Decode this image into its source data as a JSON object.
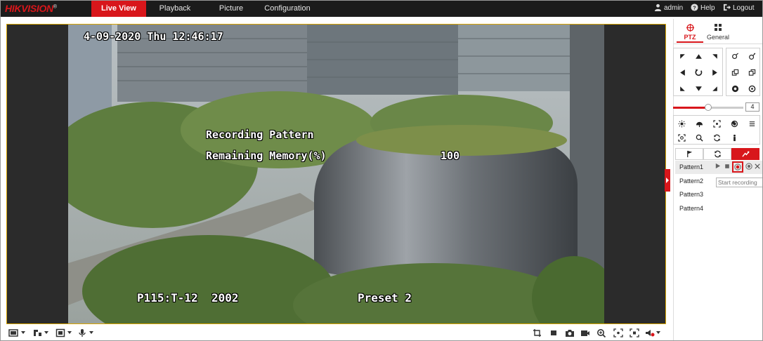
{
  "brand": {
    "logo_text": "HIKVISION",
    "logo_mark": "®"
  },
  "nav": {
    "tabs": [
      {
        "label": "Live View",
        "active": true
      },
      {
        "label": "Playback",
        "active": false
      },
      {
        "label": "Picture",
        "active": false
      },
      {
        "label": "Configuration",
        "active": false
      }
    ],
    "user": "admin",
    "help": "Help",
    "logout": "Logout"
  },
  "video": {
    "timestamp": "4-09-2020 Thu 12:46:17",
    "osd_line1": "Recording Pattern",
    "osd_line2_label": "Remaining Memory(%)",
    "osd_line2_value": "100",
    "osd_bottom_left": "P115:T-12  2002",
    "osd_bottom_right": "Preset 2"
  },
  "ptz_panel": {
    "tabs": [
      {
        "label": "PTZ",
        "icon": "ptz-crosshair-icon",
        "active": true
      },
      {
        "label": "General",
        "icon": "grid-icon",
        "active": false
      }
    ],
    "speed_value": "4",
    "speed_level": 0.5,
    "pattern_subtabs": [
      {
        "icon": "flag-icon",
        "active": false
      },
      {
        "icon": "patrol-icon",
        "active": false
      },
      {
        "icon": "pattern-icon",
        "active": true
      }
    ],
    "patterns": [
      {
        "label": "Pattern1",
        "selected": true
      },
      {
        "label": "Pattern2",
        "selected": false
      },
      {
        "label": "Pattern3",
        "selected": false
      },
      {
        "label": "Pattern4",
        "selected": false
      }
    ],
    "tooltip": "Start recording"
  },
  "colors": {
    "accent": "#d8161b",
    "topbar": "#1b1b1b",
    "frame": "#d9a400"
  }
}
